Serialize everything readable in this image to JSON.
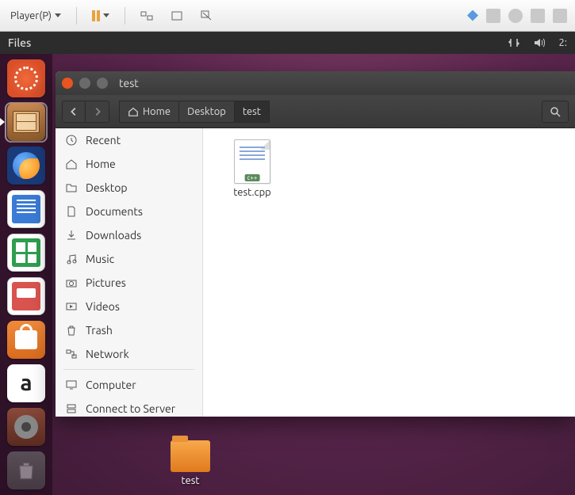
{
  "vm": {
    "player_label": "Player(P)",
    "right_icons": [
      "arrows-icon",
      "printer-icon",
      "disc-icon",
      "hdd-icon",
      "expand-icon"
    ]
  },
  "panel": {
    "app_title": "Files",
    "time": "2:"
  },
  "launcher": {
    "items": [
      {
        "name": "dash-icon"
      },
      {
        "name": "files-app-icon",
        "active": true
      },
      {
        "name": "firefox-icon"
      },
      {
        "name": "writer-icon"
      },
      {
        "name": "calc-icon"
      },
      {
        "name": "impress-icon"
      },
      {
        "name": "software-center-icon"
      },
      {
        "name": "amazon-icon"
      },
      {
        "name": "settings-icon"
      },
      {
        "name": "trash-icon"
      }
    ]
  },
  "nautilus": {
    "title": "test",
    "breadcrumbs": [
      {
        "label": "Home",
        "name": "crumb-home",
        "icon": true
      },
      {
        "label": "Desktop",
        "name": "crumb-desktop"
      },
      {
        "label": "test",
        "name": "crumb-test",
        "active": true
      }
    ],
    "sidebar": [
      {
        "label": "Recent",
        "icon": "clock-icon",
        "name": "side-recent"
      },
      {
        "label": "Home",
        "icon": "home-icon",
        "name": "side-home"
      },
      {
        "label": "Desktop",
        "icon": "folder-icon",
        "name": "side-desktop"
      },
      {
        "label": "Documents",
        "icon": "document-icon",
        "name": "side-documents"
      },
      {
        "label": "Downloads",
        "icon": "download-icon",
        "name": "side-downloads"
      },
      {
        "label": "Music",
        "icon": "music-icon",
        "name": "side-music"
      },
      {
        "label": "Pictures",
        "icon": "camera-icon",
        "name": "side-pictures"
      },
      {
        "label": "Videos",
        "icon": "video-icon",
        "name": "side-videos"
      },
      {
        "label": "Trash",
        "icon": "trash-icon",
        "name": "side-trash"
      },
      {
        "label": "Network",
        "icon": "network-icon",
        "name": "side-network"
      },
      {
        "sep": true
      },
      {
        "label": "Computer",
        "icon": "computer-icon",
        "name": "side-computer"
      },
      {
        "label": "Connect to Server",
        "icon": "server-icon",
        "name": "side-connect"
      }
    ],
    "files": [
      {
        "label": "test.cpp",
        "badge": "c++",
        "name": "file-test-cpp"
      }
    ]
  },
  "desktop": {
    "folder_label": "test"
  }
}
